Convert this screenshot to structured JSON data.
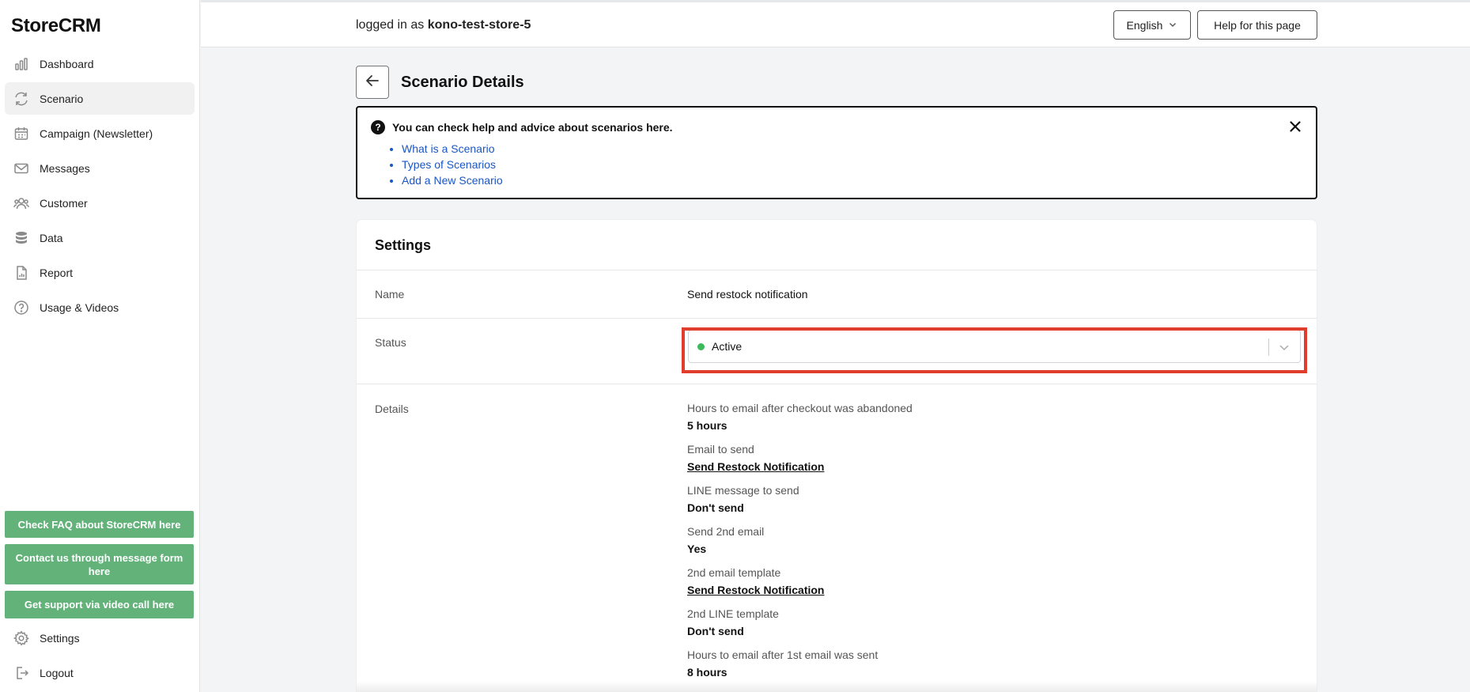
{
  "app": {
    "logo": "StoreCRM"
  },
  "sidebar": {
    "items": [
      {
        "label": "Dashboard",
        "icon": "bar-chart-icon"
      },
      {
        "label": "Scenario",
        "icon": "refresh-icon"
      },
      {
        "label": "Campaign (Newsletter)",
        "icon": "calendar-icon"
      },
      {
        "label": "Messages",
        "icon": "mail-icon"
      },
      {
        "label": "Customer",
        "icon": "users-icon"
      },
      {
        "label": "Data",
        "icon": "database-icon"
      },
      {
        "label": "Report",
        "icon": "report-icon"
      },
      {
        "label": "Usage & Videos",
        "icon": "question-circle-icon"
      }
    ],
    "active": "Scenario",
    "support_buttons": [
      "Check FAQ about StoreCRM here",
      "Contact us through message form here",
      "Get support via video call here"
    ],
    "bottom_items": [
      {
        "label": "Settings",
        "icon": "gear-icon"
      },
      {
        "label": "Logout",
        "icon": "logout-icon"
      }
    ],
    "accent_color": "#62b27a"
  },
  "header": {
    "logged_in_prefix": "logged in as",
    "store_name": "kono-test-store-5",
    "language": "English",
    "help_button": "Help for this page"
  },
  "page": {
    "title": "Scenario Details"
  },
  "help_box": {
    "heading": "You can check help and advice about scenarios here.",
    "links": [
      "What is a Scenario",
      "Types of Scenarios",
      "Add a New Scenario"
    ]
  },
  "settings": {
    "title": "Settings",
    "name_label": "Name",
    "name_value": "Send restock notification",
    "status_label": "Status",
    "status_value": "Active",
    "status_color": "#3cba5c",
    "details_label": "Details",
    "details": [
      {
        "label": "Hours to email after checkout was abandoned",
        "value": "5 hours",
        "link": false
      },
      {
        "label": "Email to send",
        "value": "Send Restock Notification",
        "link": true
      },
      {
        "label": "LINE message to send",
        "value": "Don't send",
        "link": false
      },
      {
        "label": "Send 2nd email",
        "value": "Yes",
        "link": false
      },
      {
        "label": "2nd email template",
        "value": "Send Restock Notification",
        "link": true
      },
      {
        "label": "2nd LINE template",
        "value": "Don't send",
        "link": false
      },
      {
        "label": "Hours to email after 1st email was sent",
        "value": "8 hours",
        "link": false
      }
    ]
  },
  "highlight_color": "#e13d2d"
}
